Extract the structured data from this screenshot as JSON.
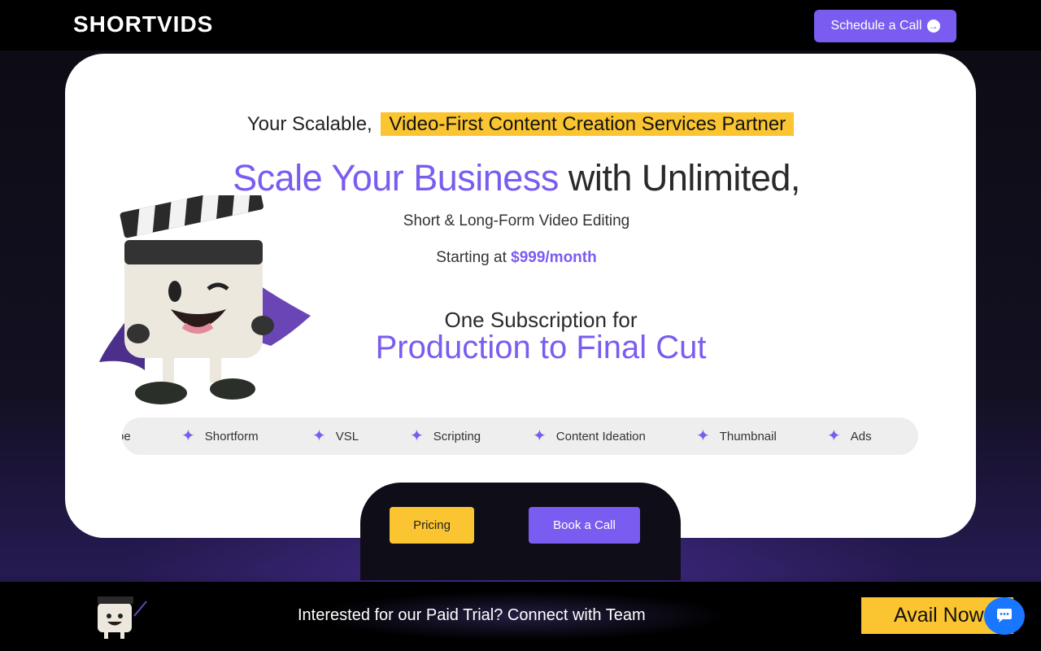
{
  "header": {
    "logo": "SHORTVIDS",
    "schedule_label": "Schedule a Call"
  },
  "hero": {
    "tagline_prefix": "Your Scalable,",
    "tagline_highlight": "Video-First Content Creation Services Partner",
    "headline_accent": "Scale Your Business",
    "headline_rest": " with Unlimited,",
    "subline": "Short & Long-Form Video Editing",
    "price_prefix": "Starting at ",
    "price_amount": "$999/month",
    "sub_title": "One Subscription for",
    "sub_big": "Production to Final Cut"
  },
  "services": [
    {
      "label": "Shortform"
    },
    {
      "label": "VSL"
    },
    {
      "label": "Scripting"
    },
    {
      "label": "Content Ideation"
    },
    {
      "label": "Thumbnail"
    },
    {
      "label": "Ads"
    }
  ],
  "services_partial": "be",
  "cta": {
    "pricing_label": "Pricing",
    "book_label": "Book a Call"
  },
  "bottom_bar": {
    "trial_text": "Interested for our Paid Trial? Connect with Team",
    "avail_label": "Avail Now"
  },
  "colors": {
    "accent": "#7b5cf0",
    "highlight": "#fbc531",
    "chat": "#1976ff"
  }
}
